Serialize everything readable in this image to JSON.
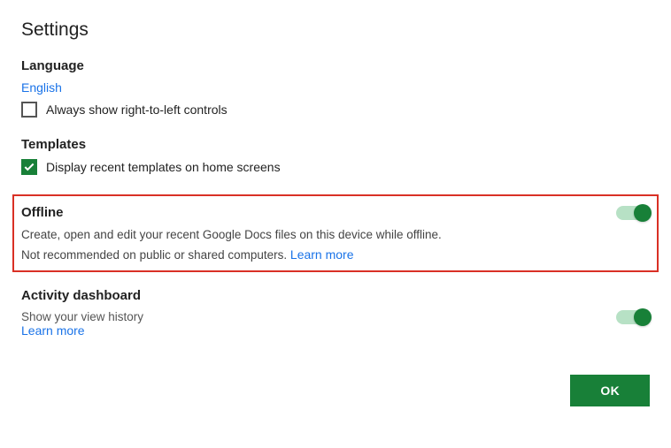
{
  "title": "Settings",
  "language": {
    "heading": "Language",
    "current": "English",
    "rtl_label": "Always show right-to-left controls",
    "rtl_checked": false
  },
  "templates": {
    "heading": "Templates",
    "display_label": "Display recent templates on home screens",
    "display_checked": true
  },
  "offline": {
    "heading": "Offline",
    "desc": "Create, open and edit your recent Google Docs files on this device while offline.",
    "warning": "Not recommended on public or shared computers. ",
    "learn_more": "Learn more",
    "enabled": true
  },
  "activity": {
    "heading": "Activity dashboard",
    "desc": "Show your view history",
    "learn_more": "Learn more",
    "enabled": true
  },
  "footer": {
    "ok": "OK"
  }
}
